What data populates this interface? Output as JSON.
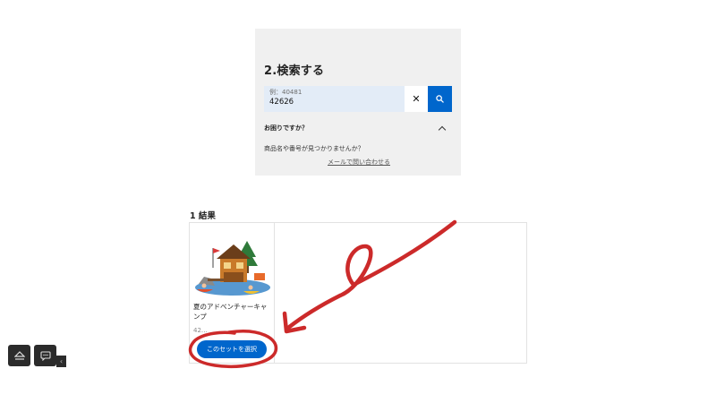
{
  "search": {
    "title": "2.検索する",
    "placeholder": "例：40481",
    "value": "42626",
    "clear_label": "✕",
    "help_title": "お困りですか？",
    "help_question": "商品名や番号が見つかりませんか？",
    "help_link": "メールで問い合わせる"
  },
  "results": {
    "count_label": "1 結果",
    "items": [
      {
        "name": "夏のアドベンチャーキャンプ",
        "number": "42…",
        "button_label": "このセットを選択"
      }
    ]
  },
  "colors": {
    "accent": "#0066cc",
    "panel_bg": "#f0f0f0",
    "annotation": "#cc2a2a"
  },
  "widgets": {
    "icons": [
      "eject-icon",
      "chat-bubble-icon",
      "chevron-left-icon"
    ]
  }
}
